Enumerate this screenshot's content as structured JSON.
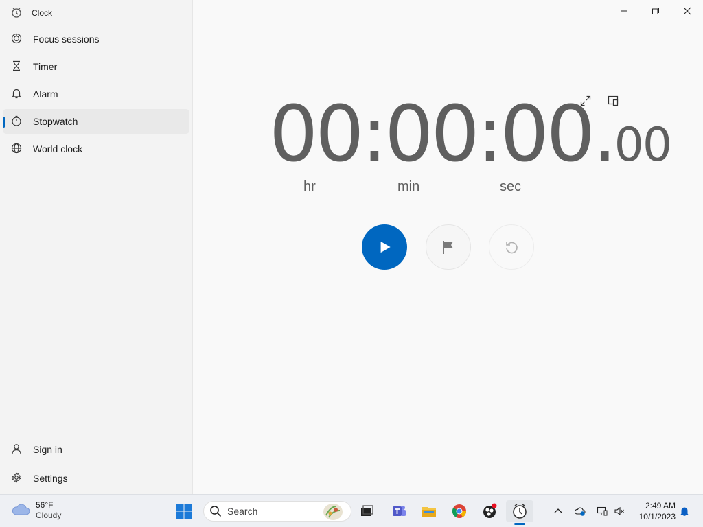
{
  "app": {
    "title": "Clock"
  },
  "nav": {
    "items": [
      {
        "label": "Focus sessions",
        "icon": "focus-icon"
      },
      {
        "label": "Timer",
        "icon": "hourglass-icon"
      },
      {
        "label": "Alarm",
        "icon": "bell-icon"
      },
      {
        "label": "Stopwatch",
        "icon": "stopwatch-icon",
        "selected": true
      },
      {
        "label": "World clock",
        "icon": "globe-icon"
      }
    ],
    "footer": [
      {
        "label": "Sign in",
        "icon": "person-icon"
      },
      {
        "label": "Settings",
        "icon": "gear-icon"
      }
    ]
  },
  "stopwatch": {
    "hours": "00",
    "minutes": "00",
    "seconds": "00",
    "hundredths": "00",
    "sep_colon": ":",
    "sep_dot": ".",
    "units": {
      "hr": "hr",
      "min": "min",
      "sec": "sec"
    }
  },
  "colors": {
    "accent": "#0067c0",
    "digits": "#5f5f5f",
    "sidebar": "#f3f3f3"
  },
  "taskbar": {
    "weather": {
      "temp": "56°F",
      "condition": "Cloudy"
    },
    "search": {
      "placeholder": "Search"
    },
    "clock": {
      "time": "2:49 AM",
      "date": "10/1/2023"
    }
  }
}
